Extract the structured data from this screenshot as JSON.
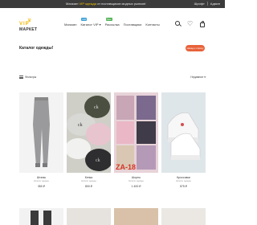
{
  "topbar": {
    "message_before": "Магазин",
    "message_highlight": "VIP одежда",
    "message_after": "от поставщиков модных рынков!",
    "lang": "Шрифт",
    "account": "Админ"
  },
  "logo": {
    "crown": "♛",
    "vip": "VIP",
    "name": "МАРКЕТ"
  },
  "nav": {
    "items": [
      {
        "label": "Магазин",
        "badge": ""
      },
      {
        "label": "Каталог VIP ▾",
        "badge": "Hot"
      },
      {
        "label": "Рассылка",
        "badge": "New"
      },
      {
        "label": "Поставщики",
        "badge": ""
      },
      {
        "label": "Контакты",
        "badge": ""
      }
    ]
  },
  "header_icons": [
    "search-icon",
    "heart-icon",
    "bag-icon"
  ],
  "catalog": {
    "title": "Каталог одежды!",
    "back_label": "Назад к списку",
    "filters_label": "Фильтры",
    "sort_label": "Недавние ▾"
  },
  "products": [
    {
      "name": "Штаны",
      "shop": "Каталог одежды",
      "price": "350 ₽"
    },
    {
      "name": "Кепка",
      "shop": "Каталог одежды",
      "price": "800 ₽"
    },
    {
      "name": "Шорты",
      "shop": "Каталог одежды",
      "price": "1 400 ₽"
    },
    {
      "name": "Кроссовки",
      "shop": "Каталог одежды",
      "price": "575 ₽"
    }
  ],
  "colors": {
    "topbar_bg": "#3b3b3b",
    "accent_gold": "#f2b600",
    "accent_orange": "#e8623a"
  }
}
